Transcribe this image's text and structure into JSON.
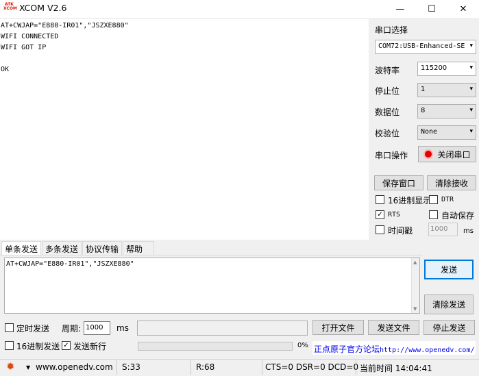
{
  "window": {
    "title": "XCOM V2.6",
    "icon_text": "ATK XCOM",
    "minimize": "—",
    "maximize": "☐",
    "close": "✕"
  },
  "receive": {
    "text": "AT+CWJAP=\"E880-IR01\",\"JSZXE880\"\nWIFI CONNECTED\nWIFI GOT IP\n\nOK"
  },
  "panel": {
    "port_select_label": "串口选择",
    "port_value": "COM72:USB-Enhanced-SE",
    "baud_label": "波特率",
    "baud_value": "115200",
    "stopbit_label": "停止位",
    "stopbit_value": "1",
    "databit_label": "数据位",
    "databit_value": "8",
    "parity_label": "校验位",
    "parity_value": "None",
    "port_op_label": "串口操作",
    "close_port_button": "关闭串口",
    "save_window_button": "保存窗口",
    "clear_receive_button": "清除接收",
    "hex_display_label": "16进制显示",
    "dtr_label": "DTR",
    "rts_label": "RTS",
    "autosave_label": "自动保存",
    "timestamp_label": "时间戳",
    "timestamp_value": "1000",
    "ms_label": "ms"
  },
  "tabs": [
    "单条发送",
    "多条发送",
    "协议传输",
    "帮助"
  ],
  "send": {
    "text": "AT+CWJAP=\"E880-IR01\",\"JSZXE880\"",
    "send_button": "发送",
    "clear_send_button": "清除发送"
  },
  "bottom": {
    "timed_send_label": "定时发送",
    "period_label": "周期:",
    "period_value": "1000",
    "ms_label": "ms",
    "open_file_button": "打开文件",
    "send_file_button": "发送文件",
    "stop_send_button": "停止发送",
    "hex_send_label": "16进制发送",
    "send_newline_label": "发送新行",
    "progress_text": "0%",
    "progress": 0,
    "forum_label": "正点原子官方论坛",
    "forum_url": "http://www.openedv.com/"
  },
  "status": {
    "website": "www.openedv.com",
    "sent": "S:33",
    "received": "R:68",
    "lines": "CTS=0 DSR=0 DCD=0",
    "time": "当前时间 14:04:41"
  }
}
